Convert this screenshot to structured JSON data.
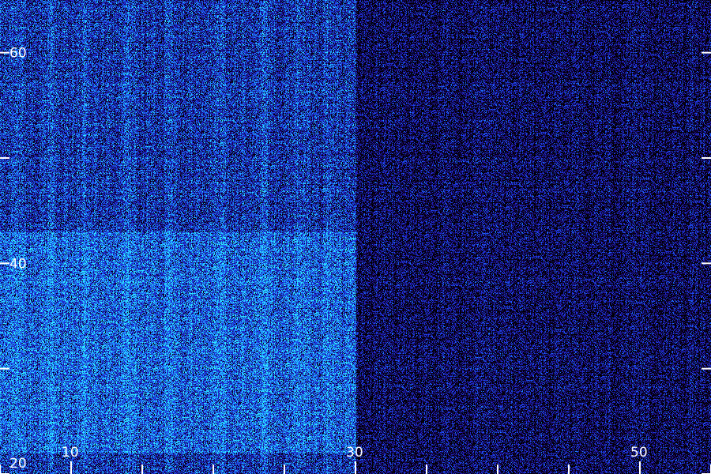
{
  "chart_data": {
    "type": "heatmap",
    "title": "",
    "xlabel": "",
    "ylabel": "",
    "xlim": [
      5,
      55
    ],
    "ylim": [
      20,
      65
    ],
    "x_major_ticks": [
      10,
      30,
      50
    ],
    "x_minor_ticks": [
      5,
      15,
      20,
      25,
      35,
      40,
      45,
      55
    ],
    "x_tick_labels": [
      "10",
      "30",
      "50"
    ],
    "y_major_ticks": [
      20,
      40,
      60
    ],
    "y_minor_ticks": [
      30,
      50
    ],
    "y_tick_labels": [
      "20",
      "40",
      "60"
    ],
    "colormap": [
      "#000000",
      "#0a0020",
      "#1a0a6a",
      "#2222cc",
      "#1a50f0",
      "#1aa0ff",
      "#30e8ff"
    ],
    "intensity_regions": [
      {
        "x_range": [
          5,
          30
        ],
        "y_range": [
          20,
          65
        ],
        "level": 0.55
      },
      {
        "x_range": [
          5,
          30
        ],
        "y_range": [
          22,
          43
        ],
        "level": 0.72
      },
      {
        "x_range": [
          30,
          55
        ],
        "y_range": [
          20,
          65
        ],
        "level": 0.32
      }
    ],
    "bright_columns_x": [
      6,
      8.5,
      11,
      14,
      17,
      20.5,
      23.5,
      26,
      28
    ],
    "grid": false,
    "legend": "none"
  }
}
